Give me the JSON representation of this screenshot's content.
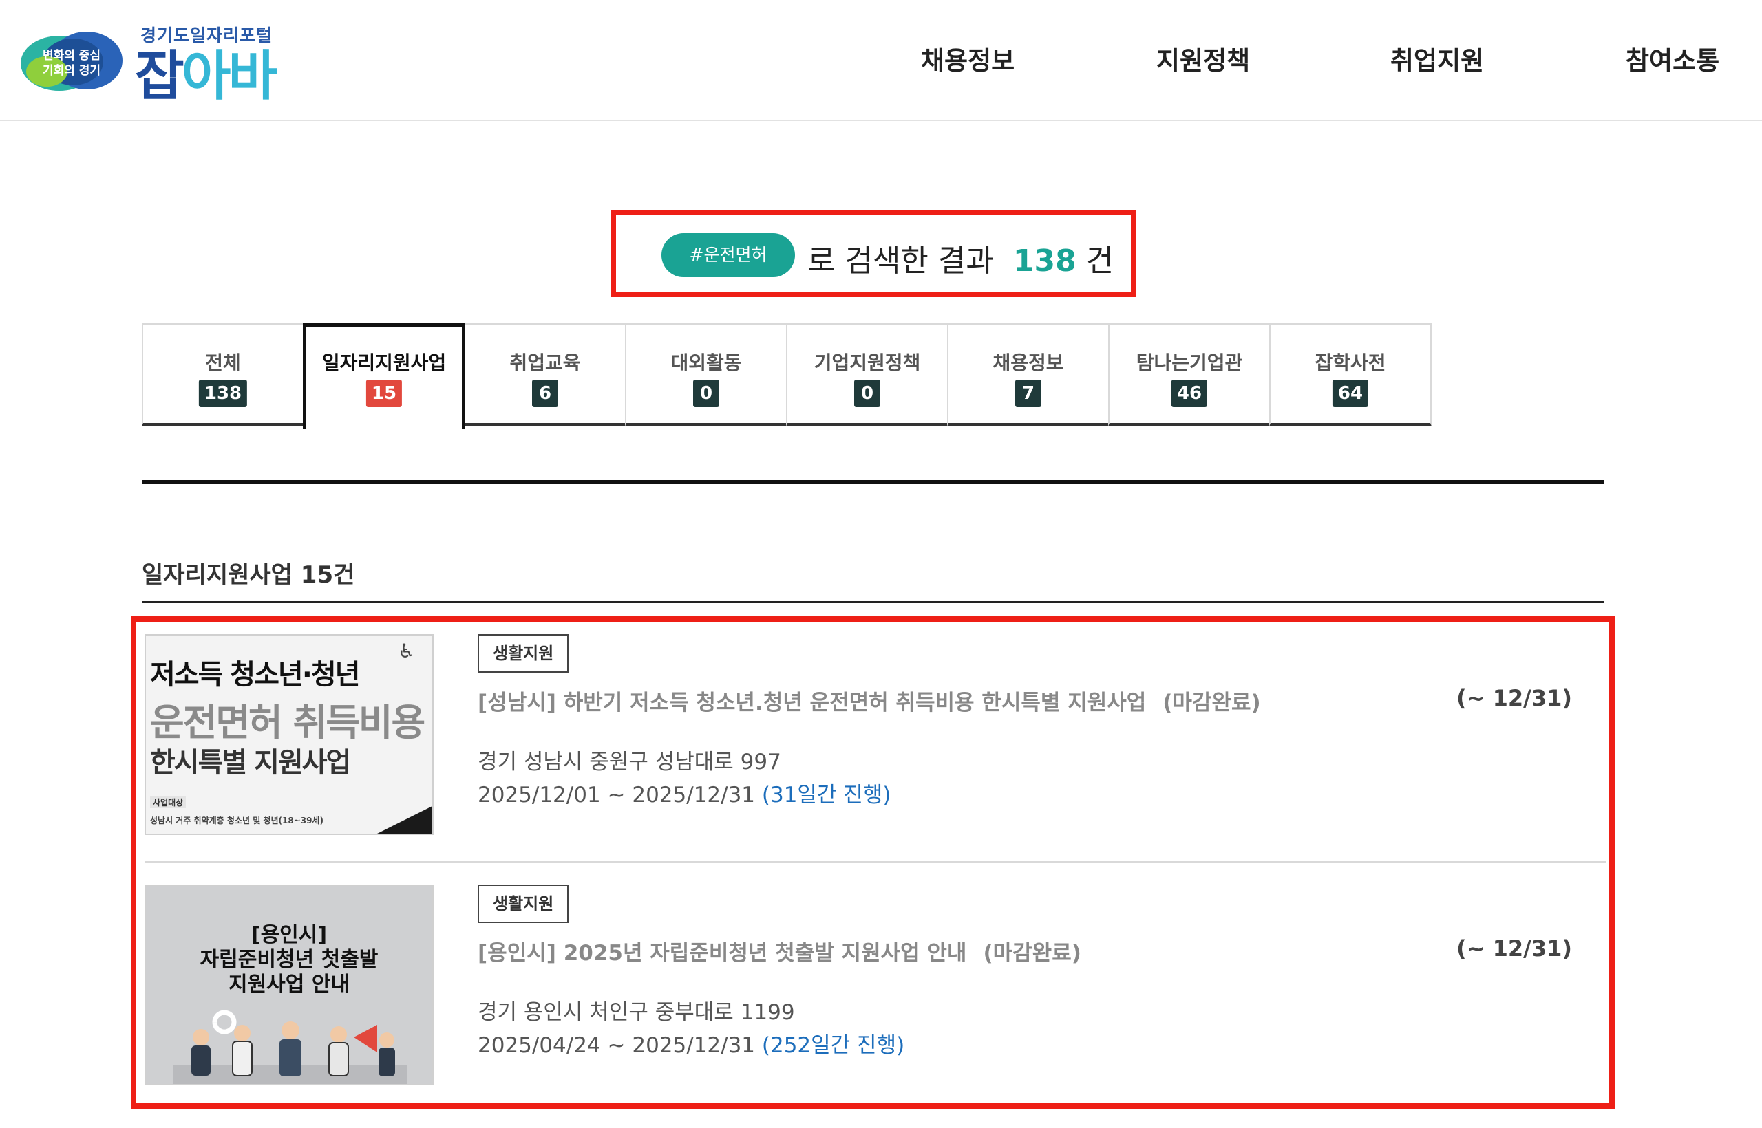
{
  "logo": {
    "badge_line1": "변화의 중심",
    "badge_line2": "기회의 경기",
    "subtitle": "경기도일자리포털",
    "name_part1": "잡",
    "name_part2": "아바"
  },
  "nav": [
    {
      "label": "채용정보"
    },
    {
      "label": "지원정책"
    },
    {
      "label": "취업지원"
    },
    {
      "label": "참여소통"
    }
  ],
  "search": {
    "keyword": "#운전면허",
    "prefix": "로 검색한 결과",
    "count": "138",
    "suffix": "건"
  },
  "tabs": [
    {
      "label": "전체",
      "count": "138"
    },
    {
      "label": "일자리지원사업",
      "count": "15",
      "active": true
    },
    {
      "label": "취업교육",
      "count": "6"
    },
    {
      "label": "대외활동",
      "count": "0"
    },
    {
      "label": "기업지원정책",
      "count": "0"
    },
    {
      "label": "채용정보",
      "count": "7"
    },
    {
      "label": "탐나는기업관",
      "count": "46"
    },
    {
      "label": "잡학사전",
      "count": "64"
    }
  ],
  "section": {
    "title": "일자리지원사업 15건"
  },
  "items": [
    {
      "category": "생활지원",
      "title": "[성남시] 하반기 저소득 청소년.청년 운전면허 취득비용 한시특별 지원사업",
      "status": "(마감완료)",
      "deadline": "(~ 12/31)",
      "address": "경기 성남시 중원구 성남대로 997",
      "period": "2025/12/01 ~ 2025/12/31",
      "days": "(31일간 진행)",
      "thumb": {
        "line1": "저소득 청소년·청년",
        "line2": "운전면허 취득비용",
        "line3": "한시특별 지원사업",
        "line4": "사업대상",
        "line5": "성남시 거주 취약계층 청소년 및 청년(18~39세)"
      }
    },
    {
      "category": "생활지원",
      "title": "[용인시] 2025년 자립준비청년 첫출발 지원사업 안내",
      "status": "(마감완료)",
      "deadline": "(~ 12/31)",
      "address": "경기 용인시 처인구 중부대로 1199",
      "period": "2025/04/24 ~ 2025/12/31",
      "days": "(252일간 진행)",
      "thumb": {
        "line1": "[용인시]",
        "line2": "자립준비청년 첫출발",
        "line3": "지원사업 안내"
      }
    }
  ],
  "colors": {
    "accent": "#1aa394",
    "highlight_border": "#ee1f16",
    "active_badge": "#e2483d",
    "badge": "#1f3a3a",
    "link": "#1c6dbb"
  }
}
